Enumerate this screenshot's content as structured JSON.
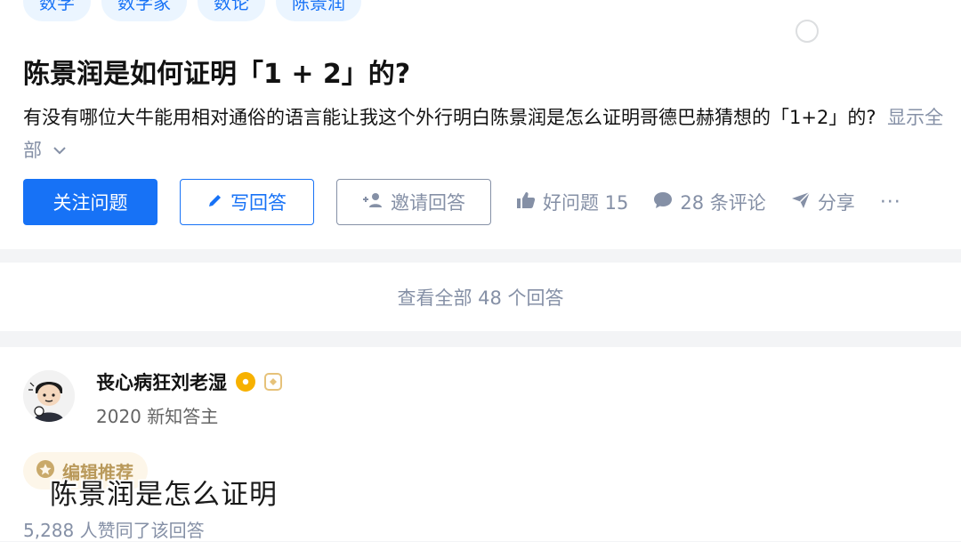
{
  "topics": [
    "数学",
    "数学家",
    "数论",
    "陈景润"
  ],
  "watermark_text": "",
  "question": {
    "title": "陈景润是如何证明「1 + 2」的?",
    "description": "有没有哪位大牛能用相对通俗的语言能让我这个外行明白陈景润是怎么证明哥德巴赫猜想的「1+2」的?",
    "show_all": "显示全部"
  },
  "actions": {
    "follow": "关注问题",
    "write": "写回答",
    "invite": "邀请回答",
    "good_question": "好问题 15",
    "comments": "28 条评论",
    "share": "分享",
    "more": "···"
  },
  "view_all_answers": "查看全部 48 个回答",
  "answer": {
    "author": "丧心病狂刘老湿",
    "author_sub": "2020 新知答主",
    "editor_pick": "编辑推荐",
    "upvotes": "5,288 人赞同了该回答"
  },
  "video_subtitle": "陈景润是怎么证明",
  "colors": {
    "accent": "#1772f6",
    "muted": "#8590a6",
    "gold": "#f7b100"
  }
}
